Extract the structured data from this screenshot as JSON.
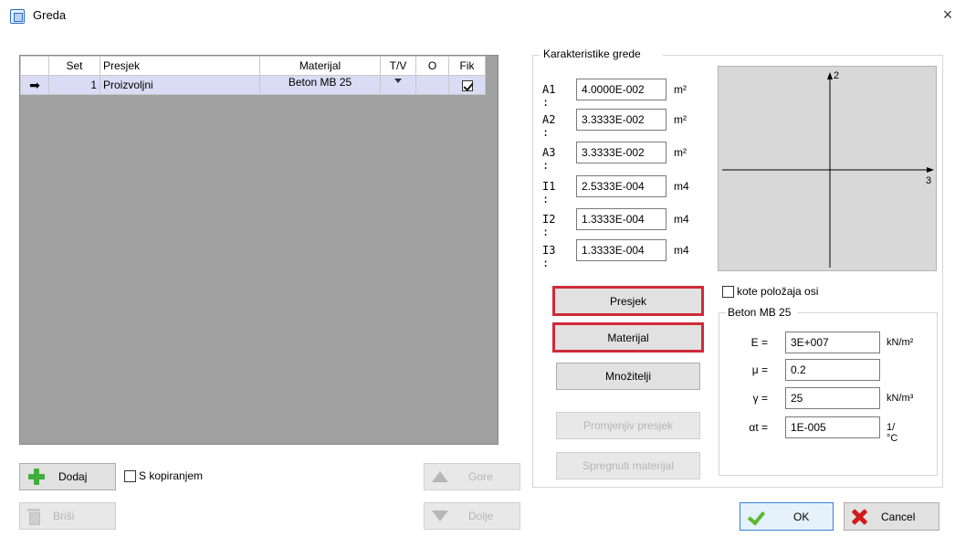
{
  "window": {
    "title": "Greda",
    "close_glyph": "×",
    "icon": "app-icon"
  },
  "table": {
    "headers": [
      "",
      "Set",
      "Presjek",
      "Materijal",
      "T/V",
      "O",
      "Fik"
    ],
    "rows": [
      {
        "indicator": "➡",
        "set": "1",
        "presjek": "Proizvoljni",
        "materijal": "Beton MB 25",
        "tv_dropdown": true,
        "o": "",
        "fik_checked": true
      }
    ]
  },
  "bottom_left": {
    "dodaj": "Dodaj",
    "s_kopiranjem": "S kopiranjem",
    "brisi": "Briši",
    "gore": "Gore",
    "dolje": "Dolje"
  },
  "karakteristike": {
    "title": "Karakteristike grede",
    "props": [
      {
        "label": "A1 :",
        "value": "4.0000E-002",
        "unit": "m²"
      },
      {
        "label": "A2 :",
        "value": "3.3333E-002",
        "unit": "m²"
      },
      {
        "label": "A3 :",
        "value": "3.3333E-002",
        "unit": "m²"
      },
      {
        "label": "I1 :",
        "value": "2.5333E-004",
        "unit": "m4"
      },
      {
        "label": "I2 :",
        "value": "1.3333E-004",
        "unit": "m4"
      },
      {
        "label": "I3 :",
        "value": "1.3333E-004",
        "unit": "m4"
      }
    ]
  },
  "axis_view": {
    "axis_vertical_label": "2",
    "axis_horizontal_label": "3"
  },
  "buttons": {
    "presjek": "Presjek",
    "materijal": "Materijal",
    "mnozitelji": "Množitelji",
    "promjeni_presjek": "Promjenjiv presjek",
    "spregnuti_materijal": "Spregnuti materijal",
    "ok": "OK",
    "cancel": "Cancel"
  },
  "kote_checkbox": "kote položaja osi",
  "material": {
    "group_title": "Beton MB 25",
    "props": [
      {
        "label": "E =",
        "value": "3E+007",
        "unit": "kN/m²"
      },
      {
        "label": "μ =",
        "value": "0.2",
        "unit": ""
      },
      {
        "label": "γ =",
        "value": "25",
        "unit": "kN/m³"
      },
      {
        "label": "αt =",
        "value": "1E-005",
        "unit": "1/°C"
      }
    ]
  },
  "colors": {
    "highlight_border": "#d12a3a",
    "selected_row": "#dadcf5",
    "ok_border": "#3b7fd6"
  }
}
